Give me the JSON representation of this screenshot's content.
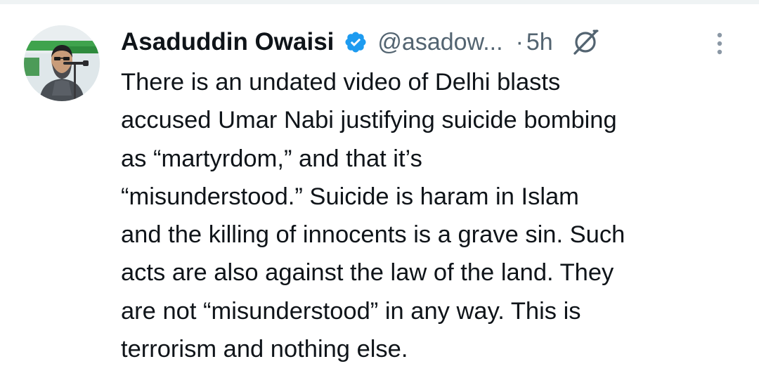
{
  "tweet": {
    "author": {
      "display_name": "Asaduddin Owaisi",
      "handle": "@asadow...",
      "verified": true,
      "verified_icon": "verified-badge-icon",
      "avatar_icon": "profile-photo"
    },
    "separator": "·",
    "timestamp": "5h",
    "grok_icon": "grok-icon",
    "more_icon": "more-options-icon",
    "text_lines": [
      "There is an undated video of Delhi blasts",
      "accused Umar Nabi justifying suicide bombing",
      "as “martyrdom,” and that  it’s",
      "“misunderstood.” Suicide is haram in Islam",
      "and the killing of innocents is a grave sin. Such",
      "acts are also against the law of the land. They",
      "are not “misunderstood” in any way. This is",
      "terrorism and nothing else."
    ]
  },
  "colors": {
    "text_primary": "#0f1419",
    "text_secondary": "#536471",
    "verified_blue": "#1d9bf0",
    "divider": "#eff3f4"
  }
}
